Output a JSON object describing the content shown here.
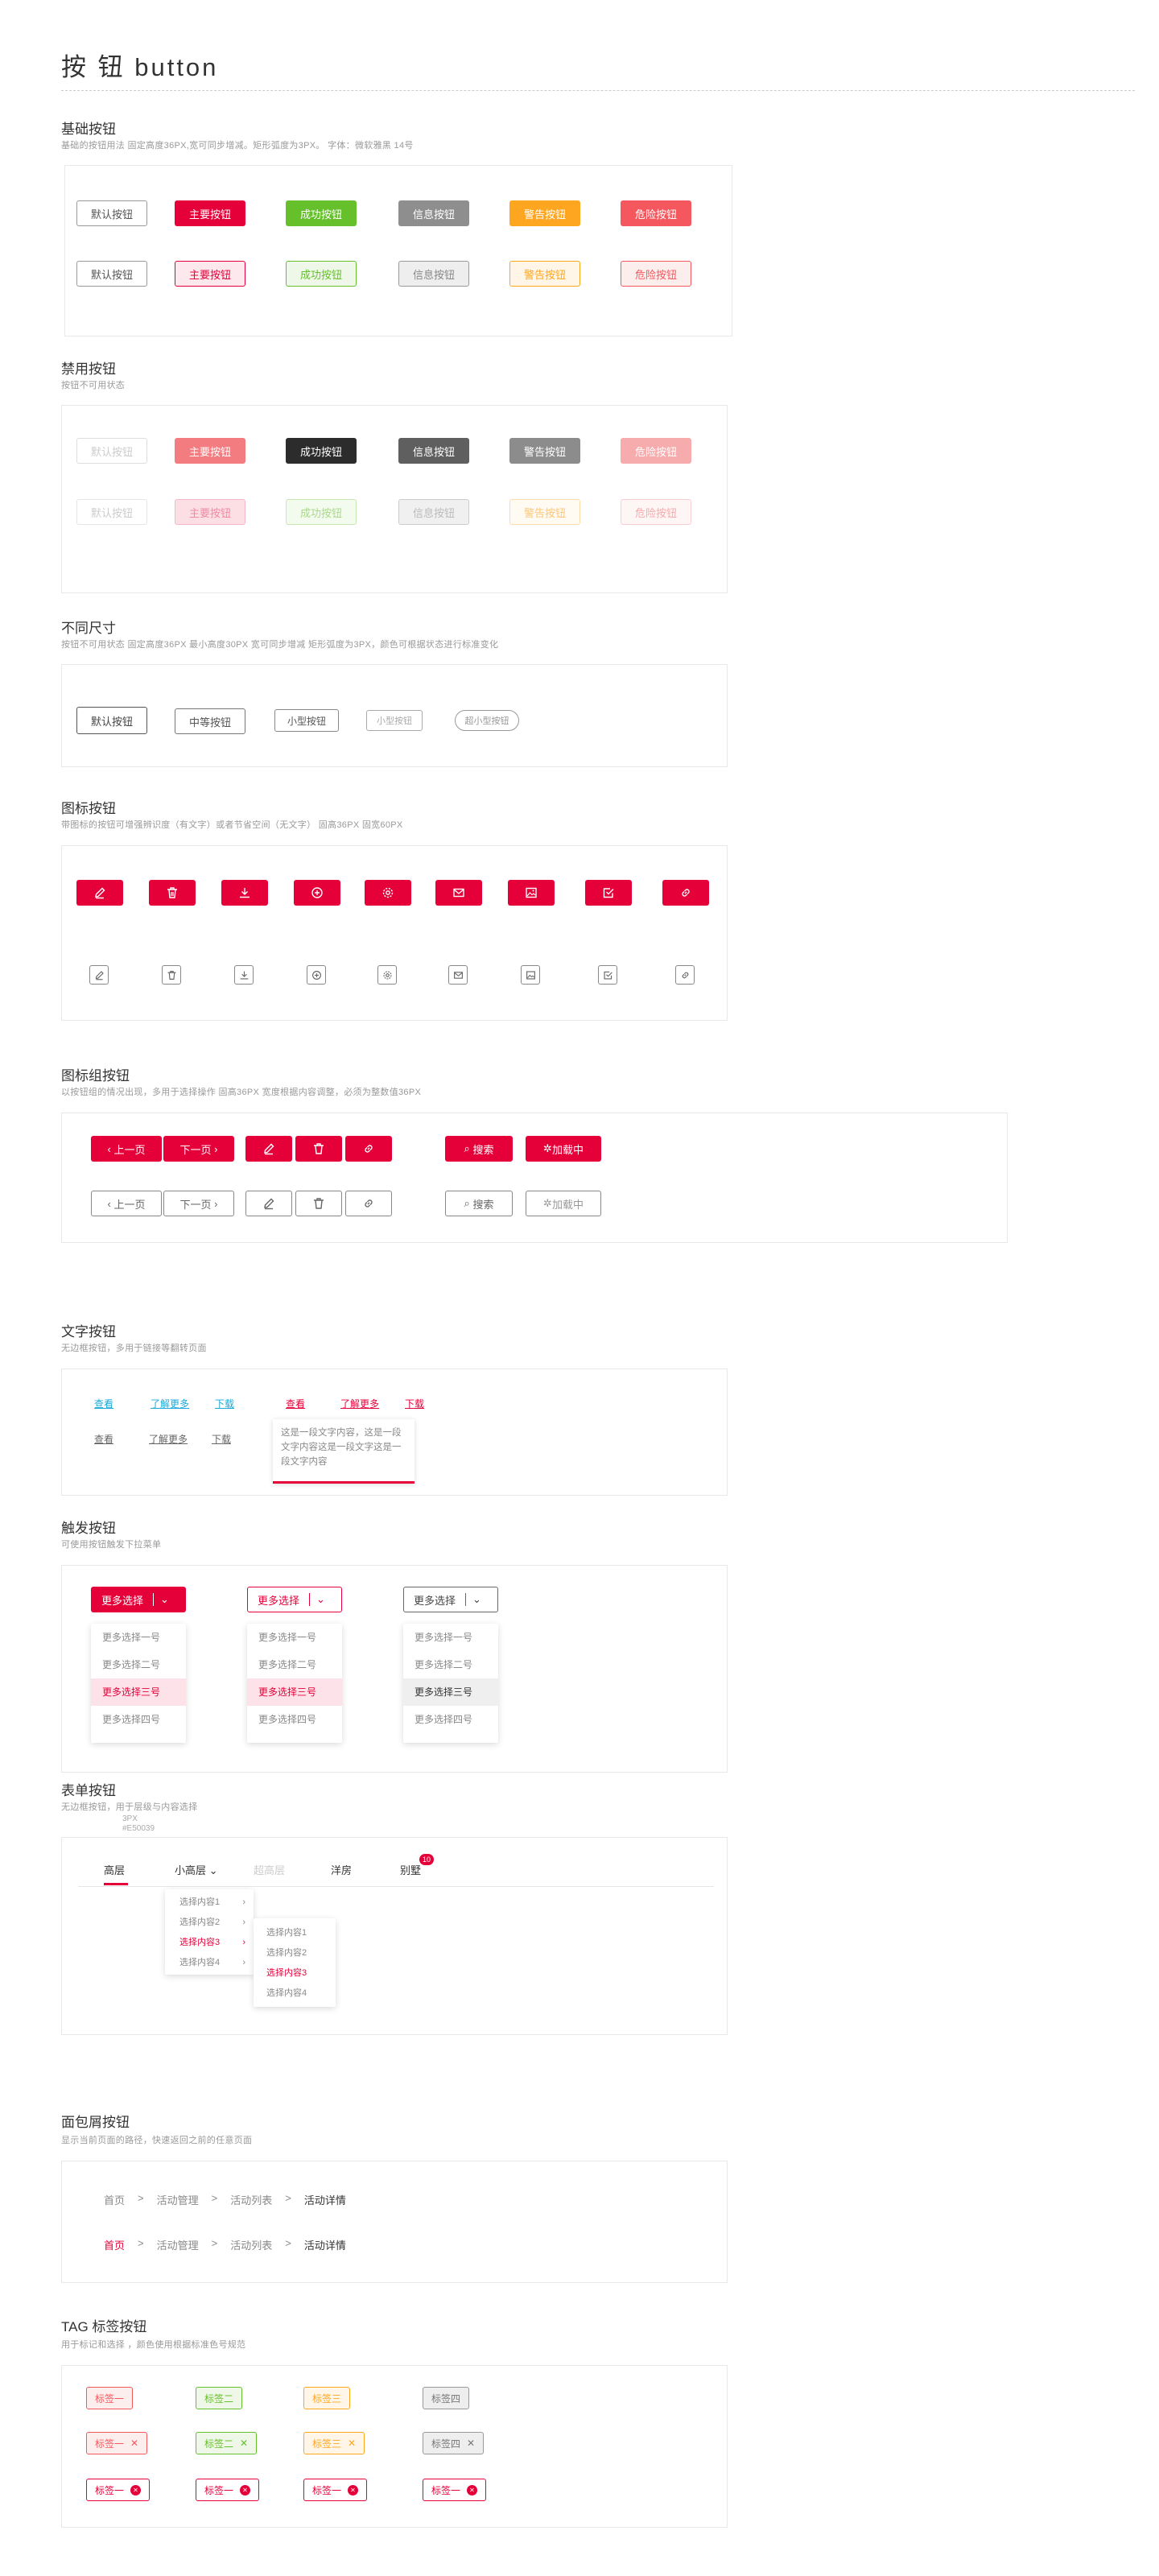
{
  "page": {
    "title": "按 钮  button"
  },
  "colors": {
    "primary": "#e50039",
    "success": "#65c02b",
    "info": "#8e8e8e",
    "warning": "#fea61f",
    "danger": "#f4575d"
  },
  "basic": {
    "title": "基础按钮",
    "desc": "基础的按钮用法    固定高度36PX,宽可同步增减。矩形弧度为3PX。    字体：微软雅黑 14号",
    "solid": [
      "默认按钮",
      "主要按钮",
      "成功按钮",
      "信息按钮",
      "警告按钮",
      "危险按钮"
    ],
    "plain": [
      "默认按钮",
      "主要按钮",
      "成功按钮",
      "信息按钮",
      "警告按钮",
      "危险按钮"
    ]
  },
  "disabled": {
    "title": "禁用按钮",
    "desc": "按钮不可用状态",
    "solid": [
      "默认按钮",
      "主要按钮",
      "成功按钮",
      "信息按钮",
      "警告按钮",
      "危险按钮"
    ],
    "plain": [
      "默认按钮",
      "主要按钮",
      "成功按钮",
      "信息按钮",
      "警告按钮",
      "危险按钮"
    ]
  },
  "sizes": {
    "title": "不同尺寸",
    "desc": "按钮不可用状态    固定高度36PX    最小高度30PX    宽可同步增减    矩形弧度为3PX，颜色可根据状态进行标准变化",
    "items": [
      "默认按钮",
      "中等按钮",
      "小型按钮",
      "小型按钮",
      "超小型按钮"
    ]
  },
  "icon_buttons": {
    "title": "图标按钮",
    "desc": "带图标的按钮可增强辨识度（有文字）或者节省空间（无文字）    固高36PX    固宽60PX",
    "icons": [
      "edit-icon",
      "trash-icon",
      "download-icon",
      "plus-circle-icon",
      "gear-icon",
      "mail-icon",
      "image-icon",
      "check-icon",
      "link-icon"
    ]
  },
  "icon_group": {
    "title": "图标组按钮",
    "desc": "以按钮组的情况出现，多用于选择操作    固高36PX    宽度根据内容调整，必须为整数值36PX",
    "prev": "上一页",
    "next": "下一页",
    "search": "搜索",
    "loading": "加载中"
  },
  "text_buttons": {
    "title": "文字按钮",
    "desc": "无边框按钮，多用于链接等翻转页面",
    "links": [
      "查看",
      "了解更多",
      "下载"
    ],
    "tooltip": "这是一段文字内容，这是一段文字内容这是一段文字这是一段文字内容"
  },
  "trigger": {
    "title": "触发按钮",
    "desc": "可使用按钮触发下拉菜单",
    "label": "更多选择",
    "options": [
      "更多选择一号",
      "更多选择二号",
      "更多选择三号",
      "更多选择四号"
    ]
  },
  "form_buttons": {
    "title": "表单按钮",
    "desc": "无边框按钮，用于层级与内容选择",
    "note_size": "3PX",
    "note_color": "#E50039",
    "tabs": [
      "高层",
      "小高层",
      "超高层",
      "洋房",
      "别墅"
    ],
    "badge": "10",
    "menu1": [
      "选择内容1",
      "选择内容2",
      "选择内容3",
      "选择内容4"
    ],
    "menu2": [
      "选择内容1",
      "选择内容2",
      "选择内容3",
      "选择内容4"
    ]
  },
  "breadcrumb": {
    "title": "面包屑按钮",
    "desc": "显示当前页面的路径，快速返回之前的任意页面",
    "items": [
      "首页",
      "活动管理",
      "活动列表",
      "活动详情"
    ],
    "sep": ">"
  },
  "tags": {
    "title": "TAG 标签按钮",
    "desc": "用于标记和选择 ，颜色使用根据标准色号规范",
    "row1": [
      "标签一",
      "标签二",
      "标签三",
      "标签四"
    ],
    "row2": [
      "标签一",
      "标签二",
      "标签三",
      "标签四"
    ],
    "row3": [
      "标签一",
      "标签一",
      "标签一",
      "标签一"
    ]
  }
}
